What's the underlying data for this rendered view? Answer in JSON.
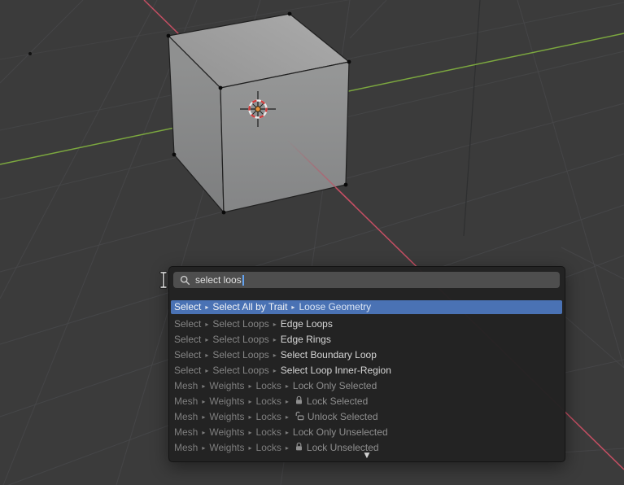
{
  "window": {
    "app_context": "blender-3d-viewport-search",
    "scene": {
      "visible_object": "cube",
      "overlay": "3d-cursor"
    }
  },
  "colors": {
    "viewport_bg": "#3b3b3b",
    "grid_line": "#48494b",
    "axis_x_red": "#c44f63",
    "axis_y_green": "#7ca83f",
    "popup_bg": "#222222",
    "field_bg": "#4e4e4e",
    "highlight_blue": "#4a72b4",
    "caret_blue": "#63a3f1",
    "cursor_ring_red": "#cf3d3d",
    "cursor_dot_orange": "#e2913c"
  },
  "search_popup": {
    "query": "select loos",
    "separator": "▸",
    "more_indicator": "▼",
    "results": [
      {
        "path": [
          "Select",
          "Select All by Trait"
        ],
        "label": "Loose Geometry",
        "state": "highlighted",
        "icon": ""
      },
      {
        "path": [
          "Select",
          "Select Loops"
        ],
        "label": "Edge Loops",
        "state": "normal",
        "icon": ""
      },
      {
        "path": [
          "Select",
          "Select Loops"
        ],
        "label": "Edge Rings",
        "state": "normal",
        "icon": ""
      },
      {
        "path": [
          "Select",
          "Select Loops"
        ],
        "label": "Select Boundary Loop",
        "state": "normal",
        "icon": ""
      },
      {
        "path": [
          "Select",
          "Select Loops"
        ],
        "label": "Select Loop Inner-Region",
        "state": "normal",
        "icon": ""
      },
      {
        "path": [
          "Mesh",
          "Weights",
          "Locks"
        ],
        "label": "Lock Only Selected",
        "state": "disabled",
        "icon": ""
      },
      {
        "path": [
          "Mesh",
          "Weights",
          "Locks"
        ],
        "label": "Lock Selected",
        "state": "disabled",
        "icon": "lock-closed-icon"
      },
      {
        "path": [
          "Mesh",
          "Weights",
          "Locks"
        ],
        "label": "Unlock Selected",
        "state": "disabled",
        "icon": "lock-open-icon"
      },
      {
        "path": [
          "Mesh",
          "Weights",
          "Locks"
        ],
        "label": "Lock Only Unselected",
        "state": "disabled",
        "icon": ""
      },
      {
        "path": [
          "Mesh",
          "Weights",
          "Locks"
        ],
        "label": "Lock Unselected",
        "state": "disabled",
        "icon": "lock-closed-icon"
      }
    ]
  }
}
